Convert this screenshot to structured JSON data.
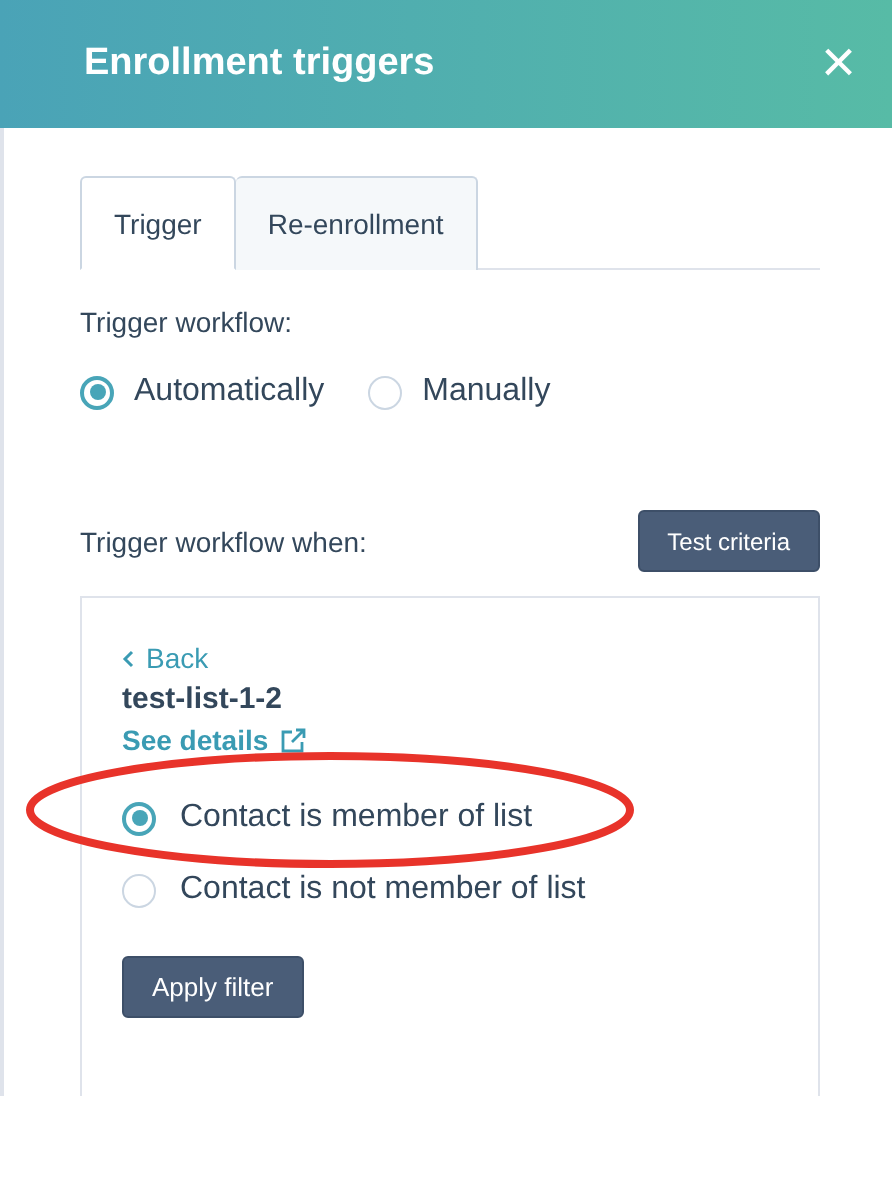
{
  "header": {
    "title": "Enrollment triggers",
    "close_label": "×"
  },
  "tabs": [
    {
      "label": "Trigger",
      "selected": true
    },
    {
      "label": "Re-enrollment",
      "selected": false
    }
  ],
  "trigger_mode": {
    "label": "Trigger workflow:",
    "options": [
      {
        "label": "Automatically",
        "selected": true
      },
      {
        "label": "Manually",
        "selected": false
      }
    ]
  },
  "criteria": {
    "label": "Trigger workflow when:",
    "test_button": "Test criteria"
  },
  "filter": {
    "back_link": "Back",
    "list_name": "test-list-1-2",
    "details_link": "See details",
    "options": [
      {
        "label": "Contact is member of list",
        "selected": true,
        "highlighted": true
      },
      {
        "label": "Contact is not member of list",
        "selected": false,
        "highlighted": false
      }
    ],
    "apply_button": "Apply filter"
  }
}
